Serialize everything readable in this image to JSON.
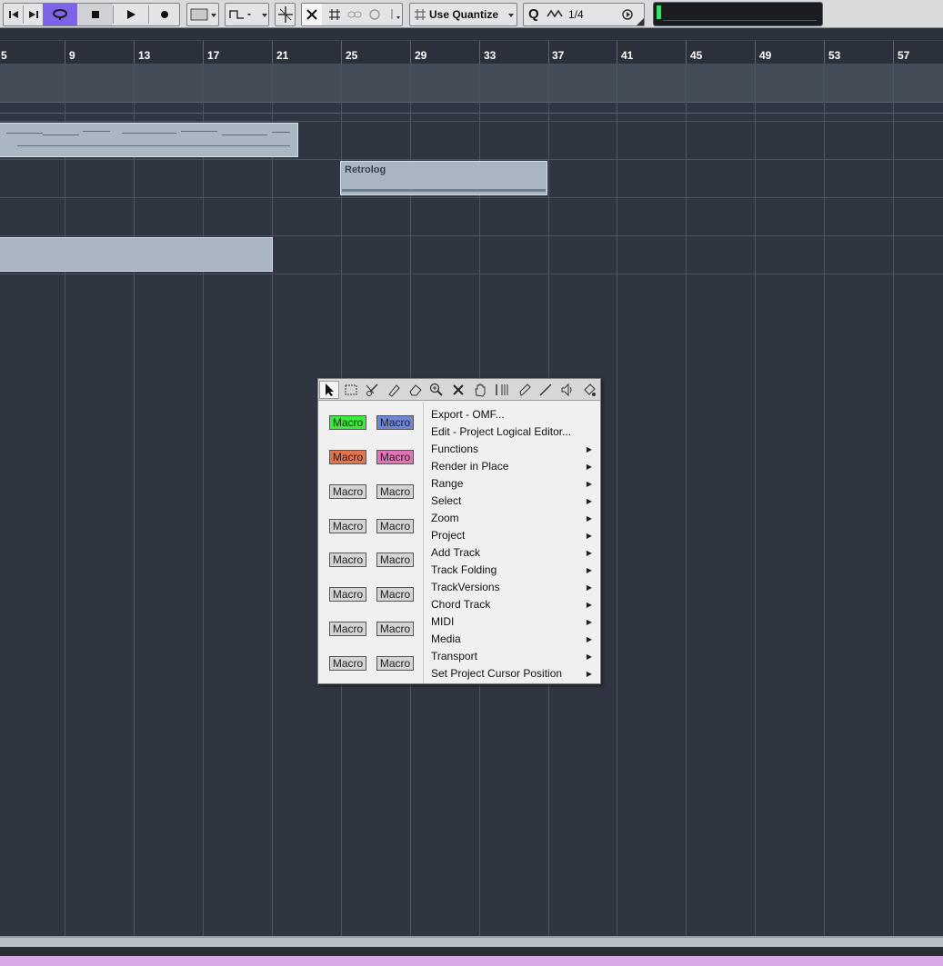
{
  "toolbar": {
    "quantize_label": "Use Quantize",
    "q_symbol": "Q",
    "grid_value": "1/4",
    "dash_label": "-"
  },
  "ruler": {
    "bars": [
      "5",
      "9",
      "13",
      "17",
      "21",
      "25",
      "29",
      "33",
      "37",
      "41",
      "45",
      "49",
      "53",
      "57"
    ]
  },
  "events": {
    "retrolog_title": "Retrolog"
  },
  "context_menu": {
    "tools": [
      "select-tool-icon",
      "range-tool-icon",
      "split-tool-icon",
      "glue-tool-icon",
      "erase-tool-icon",
      "zoom-tool-icon",
      "mute-tool-icon",
      "hand-tool-icon",
      "time-warp-tool-icon",
      "draw-tool-icon",
      "line-tool-icon",
      "play-tool-icon",
      "color-tool-icon"
    ],
    "macros": [
      {
        "label": "Macro",
        "color": "#3bea3b"
      },
      {
        "label": "Macro",
        "color": "#6f86d6"
      },
      {
        "label": "Macro",
        "color": "#e1744f"
      },
      {
        "label": "Macro",
        "color": "#e173b7"
      },
      {
        "label": "Macro",
        "color": "#d4d4d4"
      },
      {
        "label": "Macro",
        "color": "#d4d4d4"
      },
      {
        "label": "Macro",
        "color": "#d4d4d4"
      },
      {
        "label": "Macro",
        "color": "#d4d4d4"
      },
      {
        "label": "Macro",
        "color": "#d4d4d4"
      },
      {
        "label": "Macro",
        "color": "#d4d4d4"
      },
      {
        "label": "Macro",
        "color": "#d4d4d4"
      },
      {
        "label": "Macro",
        "color": "#d4d4d4"
      },
      {
        "label": "Macro",
        "color": "#d4d4d4"
      },
      {
        "label": "Macro",
        "color": "#d4d4d4"
      },
      {
        "label": "Macro",
        "color": "#d4d4d4"
      },
      {
        "label": "Macro",
        "color": "#d4d4d4"
      }
    ],
    "items": [
      {
        "label": "Export - OMF...",
        "submenu": false
      },
      {
        "label": "Edit - Project Logical Editor...",
        "submenu": false
      },
      {
        "label": "Functions",
        "submenu": true
      },
      {
        "label": "Render in Place",
        "submenu": true
      },
      {
        "label": "Range",
        "submenu": true
      },
      {
        "label": "Select",
        "submenu": true
      },
      {
        "label": "Zoom",
        "submenu": true
      },
      {
        "label": "Project",
        "submenu": true
      },
      {
        "label": "Add Track",
        "submenu": true
      },
      {
        "label": "Track Folding",
        "submenu": true
      },
      {
        "label": "TrackVersions",
        "submenu": true
      },
      {
        "label": "Chord Track",
        "submenu": true
      },
      {
        "label": "MIDI",
        "submenu": true
      },
      {
        "label": "Media",
        "submenu": true
      },
      {
        "label": "Transport",
        "submenu": true
      },
      {
        "label": "Set Project Cursor Position",
        "submenu": true
      }
    ]
  }
}
